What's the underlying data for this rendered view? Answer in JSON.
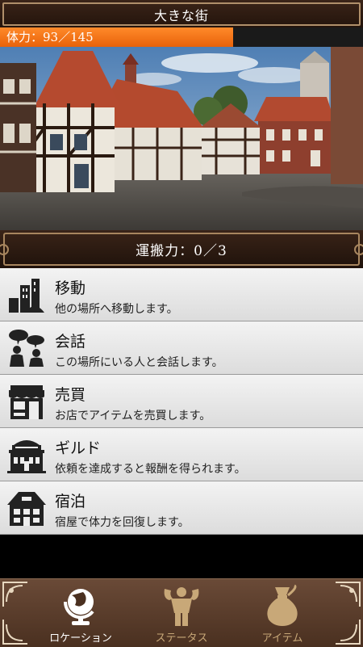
{
  "header": {
    "title": "大きな街"
  },
  "stamina": {
    "label": "体力：93／145",
    "current": 93,
    "max": 145
  },
  "capacity": {
    "label": "運搬力：0／3"
  },
  "menu": [
    {
      "icon": "town-buildings-icon",
      "title": "移動",
      "desc": "他の場所へ移動します。"
    },
    {
      "icon": "people-talking-icon",
      "title": "会話",
      "desc": "この場所にいる人と会話します。"
    },
    {
      "icon": "shop-icon",
      "title": "売買",
      "desc": "お店でアイテムを売買します。"
    },
    {
      "icon": "guild-hall-icon",
      "title": "ギルド",
      "desc": "依頼を達成すると報酬を得られます。"
    },
    {
      "icon": "inn-house-icon",
      "title": "宿泊",
      "desc": "宿屋で体力を回復します。"
    }
  ],
  "nav": [
    {
      "icon": "globe-icon",
      "label": "ロケーション",
      "active": true
    },
    {
      "icon": "strongman-icon",
      "label": "ステータス",
      "active": false
    },
    {
      "icon": "item-bag-icon",
      "label": "アイテム",
      "active": false
    }
  ],
  "colors": {
    "accent": "#ff8a2a",
    "frame": "#b08f6a",
    "nav_active": "#ffffff",
    "nav_inactive": "#c8a878"
  }
}
